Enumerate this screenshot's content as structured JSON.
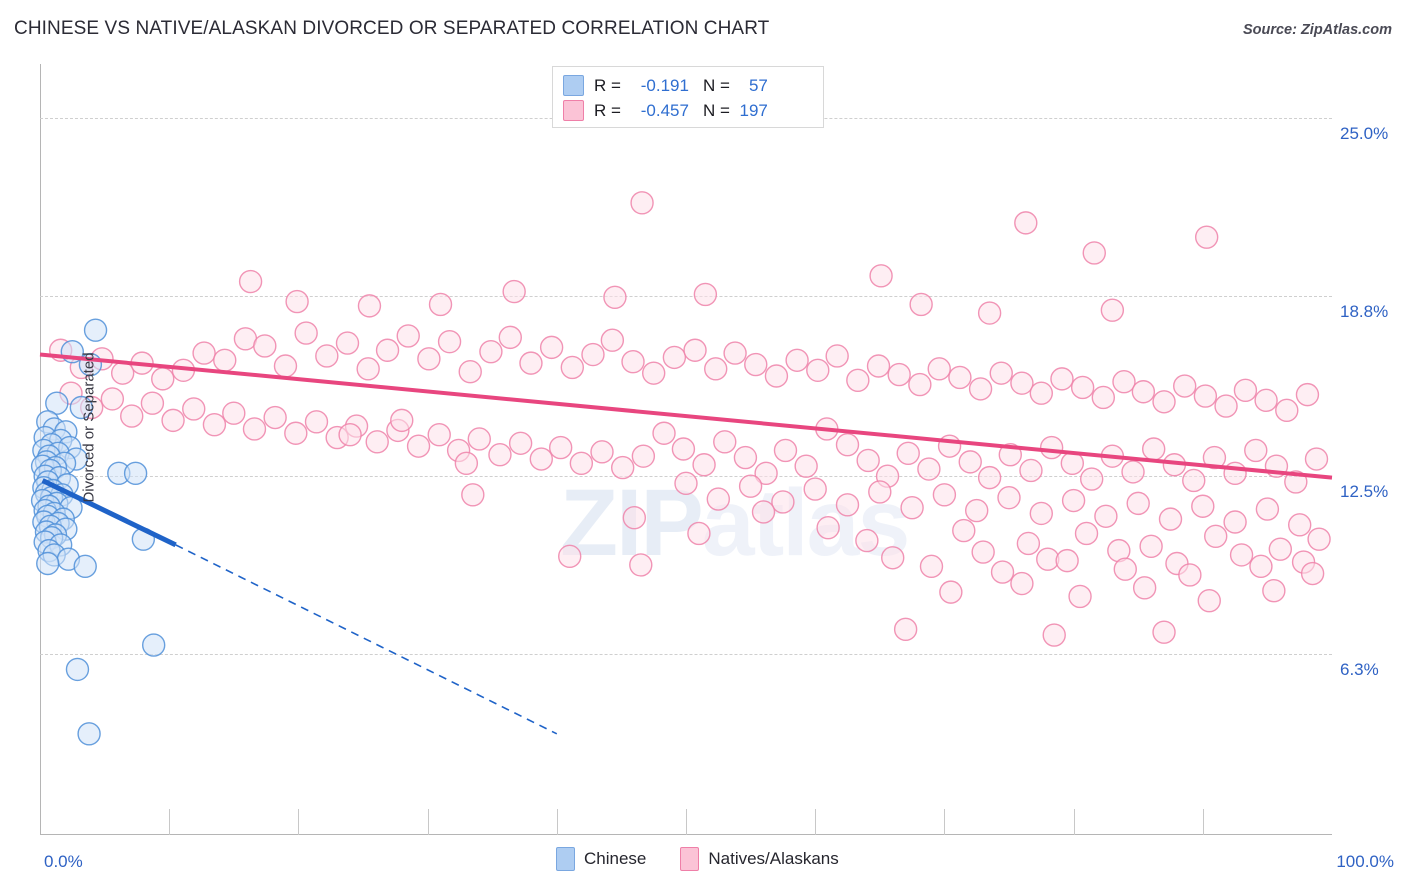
{
  "header": {
    "title": "CHINESE VS NATIVE/ALASKAN DIVORCED OR SEPARATED CORRELATION CHART",
    "source": "Source: ZipAtlas.com"
  },
  "watermark": {
    "text_dark": "ZIP",
    "text_light": "atlas"
  },
  "stats": {
    "rows": [
      {
        "series": "Chinese",
        "color": "#aecdf2",
        "r_key": "R =",
        "r_value": "-0.191",
        "n_key": "N =",
        "n_value": "57"
      },
      {
        "series": "Natives/Alaskans",
        "color": "#fbc3d6",
        "r_key": "R =",
        "r_value": "-0.457",
        "n_key": "N =",
        "n_value": "197"
      }
    ]
  },
  "legend": {
    "items": [
      {
        "label": "Chinese",
        "color": "#aecdf2",
        "border": "#7aa7e0"
      },
      {
        "label": "Natives/Alaskans",
        "color": "#fbc3d6",
        "border": "#ef7fa8"
      }
    ]
  },
  "axes": {
    "y_title": "Divorced or Separated",
    "y_ticks": [
      "25.0%",
      "18.8%",
      "12.5%",
      "6.3%"
    ],
    "x_min_label": "0.0%",
    "x_max_label": "100.0%"
  },
  "chart_data": {
    "type": "scatter",
    "title": "CHINESE VS NATIVE/ALASKAN DIVORCED OR SEPARATED CORRELATION CHART",
    "xlabel": "",
    "ylabel": "Divorced or Separated",
    "xlim": [
      0,
      100
    ],
    "ylim": [
      0,
      26.9
    ],
    "x_tick_values": [
      0,
      100
    ],
    "y_tick_values": [
      25.0,
      18.8,
      12.5,
      6.3
    ],
    "grid": "horizontal-dashed",
    "legend_position": "bottom-center",
    "colors": {
      "chinese_fill": "#cfe1f8",
      "chinese_edge": "#4f8fd8",
      "native_fill": "#fde0e9",
      "native_edge": "#ef82a9",
      "chinese_trend": "#1f63c8",
      "native_trend": "#e8467f"
    },
    "series": [
      {
        "name": "Chinese",
        "r": -0.191,
        "n": 57,
        "trendline": {
          "x0": 0.2,
          "y0": 12.35,
          "x1": 10.5,
          "y1": 10.1,
          "extrapolated_to": {
            "x": 40.0,
            "y": 3.5
          },
          "style": "solid-then-dashed"
        },
        "points": [
          [
            4.3,
            17.6
          ],
          [
            2.5,
            16.85
          ],
          [
            3.9,
            16.4
          ],
          [
            1.3,
            15.05
          ],
          [
            3.2,
            14.9
          ],
          [
            0.6,
            14.4
          ],
          [
            1.1,
            14.15
          ],
          [
            2.0,
            14.05
          ],
          [
            0.4,
            13.85
          ],
          [
            1.6,
            13.75
          ],
          [
            0.9,
            13.6
          ],
          [
            2.3,
            13.5
          ],
          [
            0.3,
            13.4
          ],
          [
            1.4,
            13.3
          ],
          [
            0.7,
            13.2
          ],
          [
            2.8,
            13.1
          ],
          [
            0.5,
            13.0
          ],
          [
            1.9,
            12.95
          ],
          [
            0.2,
            12.85
          ],
          [
            1.2,
            12.8
          ],
          [
            0.8,
            12.7
          ],
          [
            6.1,
            12.6
          ],
          [
            7.4,
            12.6
          ],
          [
            0.4,
            12.5
          ],
          [
            1.5,
            12.45
          ],
          [
            0.6,
            12.3
          ],
          [
            2.1,
            12.2
          ],
          [
            0.3,
            12.1
          ],
          [
            1.0,
            12.0
          ],
          [
            0.5,
            11.9
          ],
          [
            1.7,
            11.85
          ],
          [
            0.9,
            11.75
          ],
          [
            0.2,
            11.65
          ],
          [
            1.3,
            11.55
          ],
          [
            0.7,
            11.45
          ],
          [
            2.4,
            11.4
          ],
          [
            0.4,
            11.3
          ],
          [
            1.1,
            11.2
          ],
          [
            0.6,
            11.1
          ],
          [
            1.8,
            11.0
          ],
          [
            0.3,
            10.9
          ],
          [
            1.4,
            10.85
          ],
          [
            0.8,
            10.75
          ],
          [
            2.0,
            10.65
          ],
          [
            0.5,
            10.55
          ],
          [
            1.2,
            10.45
          ],
          [
            0.9,
            10.35
          ],
          [
            8.0,
            10.3
          ],
          [
            0.4,
            10.2
          ],
          [
            1.6,
            10.1
          ],
          [
            0.7,
            9.9
          ],
          [
            1.1,
            9.75
          ],
          [
            2.2,
            9.6
          ],
          [
            0.6,
            9.45
          ],
          [
            3.5,
            9.35
          ],
          [
            8.8,
            6.6
          ],
          [
            2.9,
            5.75
          ],
          [
            3.8,
            3.5
          ]
        ]
      },
      {
        "name": "Natives/Alaskans",
        "r": -0.457,
        "n": 197,
        "trendline": {
          "x0": 0.0,
          "y0": 16.75,
          "x1": 100.0,
          "y1": 12.45,
          "style": "solid"
        },
        "points": [
          [
            46.6,
            22.05
          ],
          [
            81.6,
            20.3
          ],
          [
            76.3,
            21.35
          ],
          [
            90.3,
            20.85
          ],
          [
            65.1,
            19.5
          ],
          [
            16.3,
            19.3
          ],
          [
            36.7,
            18.95
          ],
          [
            19.9,
            18.6
          ],
          [
            25.5,
            18.45
          ],
          [
            31.0,
            18.5
          ],
          [
            44.5,
            18.75
          ],
          [
            51.5,
            18.85
          ],
          [
            68.2,
            18.5
          ],
          [
            73.5,
            18.2
          ],
          [
            83.0,
            18.3
          ],
          [
            1.6,
            16.9
          ],
          [
            3.2,
            16.3
          ],
          [
            4.8,
            16.6
          ],
          [
            6.4,
            16.1
          ],
          [
            7.9,
            16.45
          ],
          [
            9.5,
            15.9
          ],
          [
            11.1,
            16.2
          ],
          [
            12.7,
            16.8
          ],
          [
            14.3,
            16.55
          ],
          [
            15.9,
            17.3
          ],
          [
            17.4,
            17.05
          ],
          [
            19.0,
            16.35
          ],
          [
            20.6,
            17.5
          ],
          [
            22.2,
            16.7
          ],
          [
            23.8,
            17.15
          ],
          [
            25.4,
            16.25
          ],
          [
            26.9,
            16.9
          ],
          [
            28.5,
            17.4
          ],
          [
            30.1,
            16.6
          ],
          [
            31.7,
            17.2
          ],
          [
            33.3,
            16.15
          ],
          [
            34.9,
            16.85
          ],
          [
            36.4,
            17.35
          ],
          [
            38.0,
            16.45
          ],
          [
            39.6,
            17.0
          ],
          [
            41.2,
            16.3
          ],
          [
            42.8,
            16.75
          ],
          [
            44.3,
            17.25
          ],
          [
            45.9,
            16.5
          ],
          [
            47.5,
            16.1
          ],
          [
            49.1,
            16.65
          ],
          [
            50.7,
            16.9
          ],
          [
            52.3,
            16.25
          ],
          [
            53.8,
            16.8
          ],
          [
            55.4,
            16.4
          ],
          [
            57.0,
            16.0
          ],
          [
            58.6,
            16.55
          ],
          [
            60.2,
            16.2
          ],
          [
            61.7,
            16.7
          ],
          [
            63.3,
            15.85
          ],
          [
            64.9,
            16.35
          ],
          [
            66.5,
            16.05
          ],
          [
            68.1,
            15.7
          ],
          [
            69.6,
            16.25
          ],
          [
            71.2,
            15.95
          ],
          [
            72.8,
            15.55
          ],
          [
            74.4,
            16.1
          ],
          [
            76.0,
            15.75
          ],
          [
            77.5,
            15.4
          ],
          [
            79.1,
            15.9
          ],
          [
            80.7,
            15.6
          ],
          [
            82.3,
            15.25
          ],
          [
            83.9,
            15.8
          ],
          [
            85.4,
            15.45
          ],
          [
            87.0,
            15.1
          ],
          [
            88.6,
            15.65
          ],
          [
            90.2,
            15.3
          ],
          [
            91.8,
            14.95
          ],
          [
            93.3,
            15.5
          ],
          [
            94.9,
            15.15
          ],
          [
            96.5,
            14.8
          ],
          [
            98.1,
            15.35
          ],
          [
            2.4,
            15.4
          ],
          [
            4.0,
            14.9
          ],
          [
            5.6,
            15.2
          ],
          [
            7.1,
            14.6
          ],
          [
            8.7,
            15.05
          ],
          [
            10.3,
            14.45
          ],
          [
            11.9,
            14.85
          ],
          [
            13.5,
            14.3
          ],
          [
            15.0,
            14.7
          ],
          [
            16.6,
            14.15
          ],
          [
            18.2,
            14.55
          ],
          [
            19.8,
            14.0
          ],
          [
            21.4,
            14.4
          ],
          [
            23.0,
            13.85
          ],
          [
            24.5,
            14.25
          ],
          [
            26.1,
            13.7
          ],
          [
            27.7,
            14.1
          ],
          [
            29.3,
            13.55
          ],
          [
            30.9,
            13.95
          ],
          [
            32.4,
            13.4
          ],
          [
            34.0,
            13.8
          ],
          [
            35.6,
            13.25
          ],
          [
            37.2,
            13.65
          ],
          [
            38.8,
            13.1
          ],
          [
            40.3,
            13.5
          ],
          [
            41.9,
            12.95
          ],
          [
            43.5,
            13.35
          ],
          [
            45.1,
            12.8
          ],
          [
            46.7,
            13.2
          ],
          [
            48.3,
            14.0
          ],
          [
            49.8,
            13.45
          ],
          [
            51.4,
            12.9
          ],
          [
            53.0,
            13.7
          ],
          [
            54.6,
            13.15
          ],
          [
            56.2,
            12.6
          ],
          [
            57.7,
            13.4
          ],
          [
            59.3,
            12.85
          ],
          [
            60.9,
            14.15
          ],
          [
            62.5,
            13.6
          ],
          [
            64.1,
            13.05
          ],
          [
            65.6,
            12.5
          ],
          [
            67.2,
            13.3
          ],
          [
            68.8,
            12.75
          ],
          [
            70.4,
            13.55
          ],
          [
            72.0,
            13.0
          ],
          [
            73.5,
            12.45
          ],
          [
            75.1,
            13.25
          ],
          [
            76.7,
            12.7
          ],
          [
            78.3,
            13.5
          ],
          [
            79.9,
            12.95
          ],
          [
            81.4,
            12.4
          ],
          [
            83.0,
            13.2
          ],
          [
            84.6,
            12.65
          ],
          [
            86.2,
            13.45
          ],
          [
            87.8,
            12.9
          ],
          [
            89.3,
            12.35
          ],
          [
            90.9,
            13.15
          ],
          [
            92.5,
            12.6
          ],
          [
            94.1,
            13.4
          ],
          [
            95.7,
            12.85
          ],
          [
            97.2,
            12.3
          ],
          [
            98.8,
            13.1
          ],
          [
            50.0,
            12.25
          ],
          [
            52.5,
            11.7
          ],
          [
            55.0,
            12.15
          ],
          [
            57.5,
            11.6
          ],
          [
            60.0,
            12.05
          ],
          [
            62.5,
            11.5
          ],
          [
            65.0,
            11.95
          ],
          [
            67.5,
            11.4
          ],
          [
            70.0,
            11.85
          ],
          [
            72.5,
            11.3
          ],
          [
            75.0,
            11.75
          ],
          [
            77.5,
            11.2
          ],
          [
            80.0,
            11.65
          ],
          [
            82.5,
            11.1
          ],
          [
            85.0,
            11.55
          ],
          [
            87.5,
            11.0
          ],
          [
            90.0,
            11.45
          ],
          [
            92.5,
            10.9
          ],
          [
            95.0,
            11.35
          ],
          [
            97.5,
            10.8
          ],
          [
            33.5,
            11.85
          ],
          [
            46.0,
            11.05
          ],
          [
            51.0,
            10.5
          ],
          [
            56.0,
            11.25
          ],
          [
            61.0,
            10.7
          ],
          [
            64.0,
            10.25
          ],
          [
            71.5,
            10.6
          ],
          [
            76.5,
            10.15
          ],
          [
            81.0,
            10.5
          ],
          [
            86.0,
            10.05
          ],
          [
            91.0,
            10.4
          ],
          [
            96.0,
            9.95
          ],
          [
            99.0,
            10.3
          ],
          [
            73.0,
            9.85
          ],
          [
            78.0,
            9.6
          ],
          [
            83.5,
            9.9
          ],
          [
            88.0,
            9.45
          ],
          [
            93.0,
            9.75
          ],
          [
            97.8,
            9.5
          ],
          [
            41.0,
            9.7
          ],
          [
            46.5,
            9.4
          ],
          [
            66.0,
            9.65
          ],
          [
            69.0,
            9.35
          ],
          [
            74.5,
            9.15
          ],
          [
            79.5,
            9.55
          ],
          [
            84.0,
            9.25
          ],
          [
            89.0,
            9.05
          ],
          [
            94.5,
            9.35
          ],
          [
            98.5,
            9.1
          ],
          [
            70.5,
            8.45
          ],
          [
            76.0,
            8.75
          ],
          [
            80.5,
            8.3
          ],
          [
            85.5,
            8.6
          ],
          [
            90.5,
            8.15
          ],
          [
            95.5,
            8.5
          ],
          [
            67.0,
            7.15
          ],
          [
            78.5,
            6.95
          ],
          [
            87.0,
            7.05
          ],
          [
            33.0,
            12.95
          ],
          [
            24.0,
            13.95
          ],
          [
            28.0,
            14.45
          ]
        ]
      }
    ]
  }
}
